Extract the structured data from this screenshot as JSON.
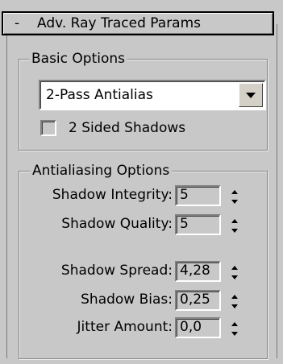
{
  "rollout": {
    "toggle_symbol": "-",
    "title": "Adv. Ray Traced Params"
  },
  "basic_options": {
    "label": "Basic Options",
    "mode_dropdown": {
      "selected": "2-Pass Antialias",
      "arrow_icon": "chevron-down-icon"
    },
    "two_sided_shadows": {
      "label": "2 Sided Shadows",
      "checked": false
    }
  },
  "antialiasing_options": {
    "label": "Antialiasing Options",
    "params": [
      {
        "label": "Shadow Integrity:",
        "value": "5"
      },
      {
        "label": "Shadow Quality:",
        "value": "5"
      },
      {
        "label": "Shadow Spread:",
        "value": "4,28"
      },
      {
        "label": "Shadow Bias:",
        "value": "0,25"
      },
      {
        "label": "Jitter Amount:",
        "value": "0,0"
      }
    ]
  },
  "colors": {
    "panel_bg": "#c8c8c8",
    "field_bg": "#ffffff",
    "header_border": "#000000"
  }
}
